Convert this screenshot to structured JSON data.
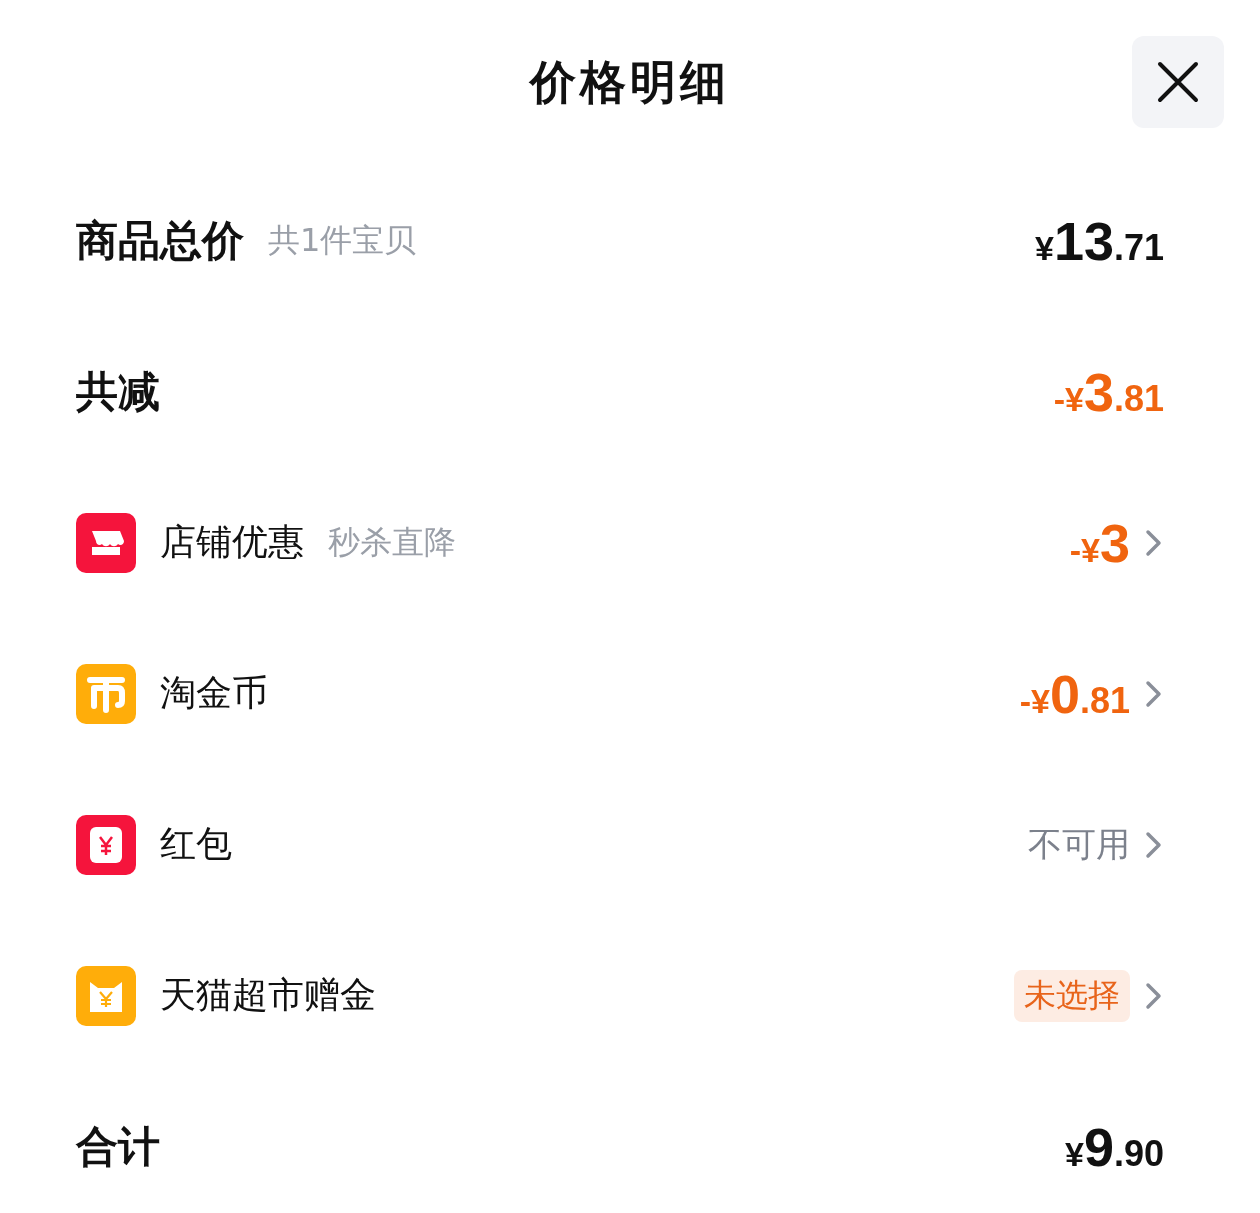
{
  "title": "价格明细",
  "rows": [
    {
      "kind": "summary",
      "label": "商品总价",
      "note": "共1件宝贝",
      "value": {
        "kind": "amount",
        "color": "#111111",
        "prefix": "¥",
        "main": "13",
        "decimal": ".71"
      }
    },
    {
      "kind": "summary",
      "label": "共减",
      "value": {
        "kind": "amount",
        "color": "#f0640f",
        "prefix": "-¥",
        "main": "3",
        "decimal": ".81"
      }
    },
    {
      "kind": "item",
      "label": "店铺优惠",
      "note": "秒杀直降",
      "value": {
        "kind": "amount",
        "color": "#f0640f",
        "prefix": "-¥",
        "main": "3"
      }
    },
    {
      "kind": "item",
      "label": "淘金币",
      "value": {
        "kind": "amount",
        "color": "#f0640f",
        "prefix": "-¥",
        "main": "0",
        "decimal": ".81"
      }
    },
    {
      "kind": "item",
      "label": "红包",
      "value": {
        "kind": "text",
        "text": "不可用"
      }
    },
    {
      "kind": "item",
      "label": "天猫超市赠金",
      "value": {
        "kind": "tag",
        "text": "未选择"
      }
    },
    {
      "kind": "summary",
      "label": "合计",
      "value": {
        "kind": "amount",
        "color": "#111111",
        "prefix": "¥",
        "main": "9",
        "decimal": ".90"
      }
    }
  ]
}
